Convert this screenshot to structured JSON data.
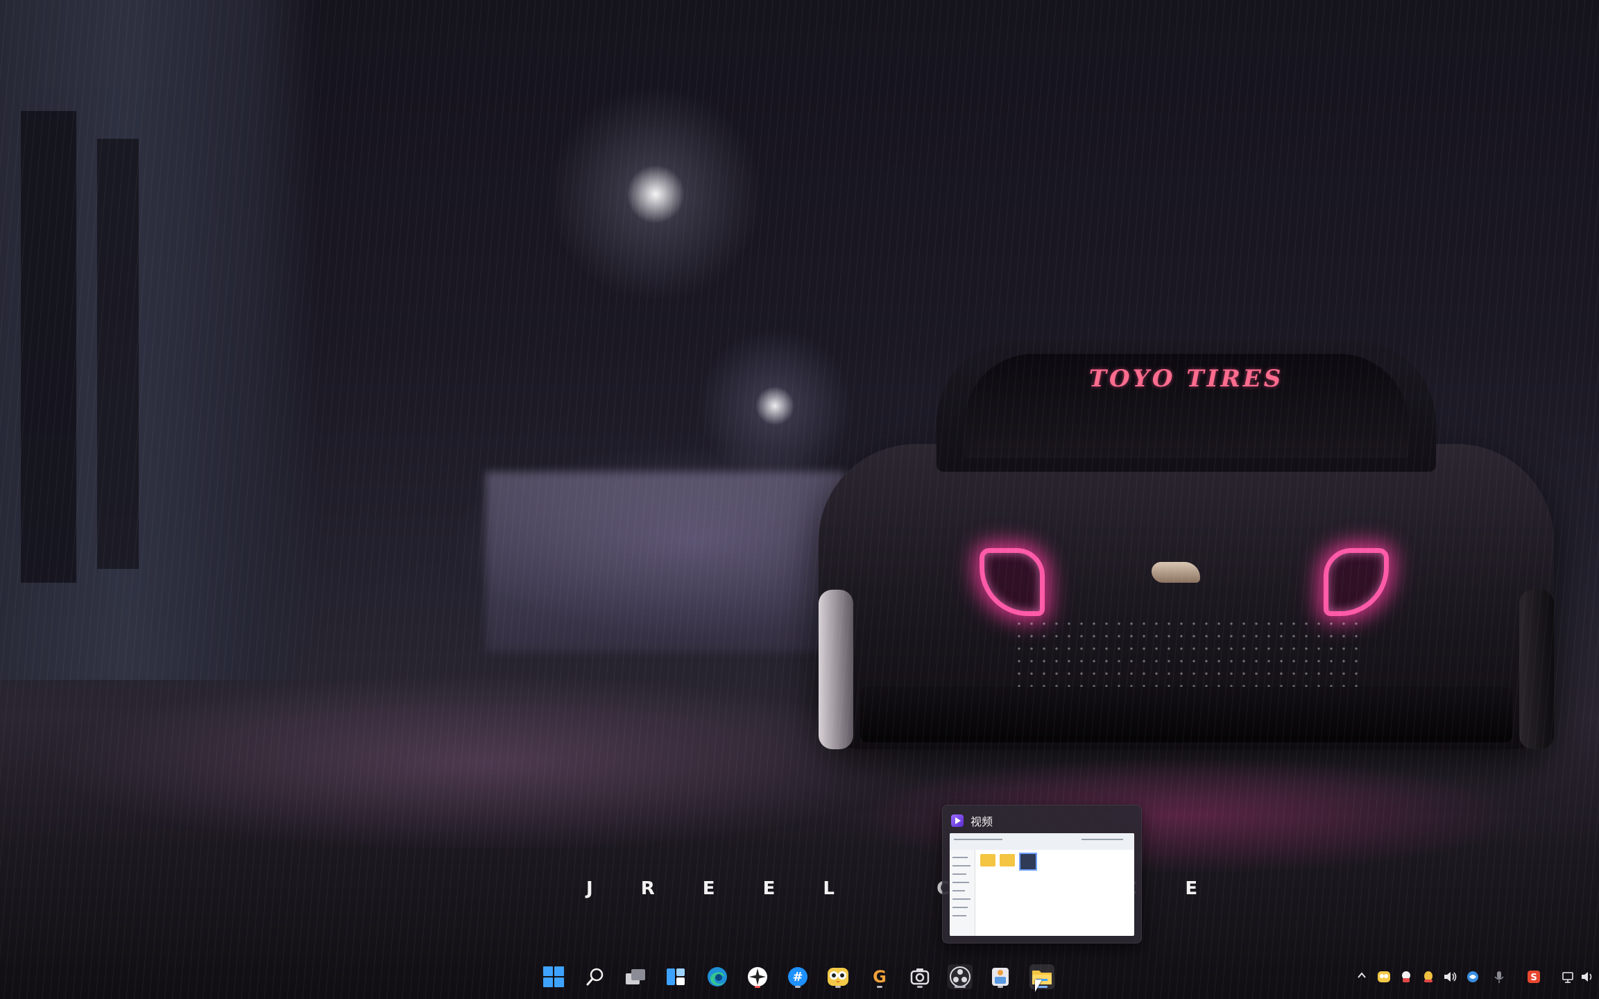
{
  "wallpaper": {
    "windshield_banner": "TOYO TIRES",
    "caption": "J R E E L   C O N C E"
  },
  "thumbnail_popup": {
    "window_title": "视频"
  },
  "taskbar": {
    "pinned": [
      {
        "name": "start-icon"
      },
      {
        "name": "search-icon"
      },
      {
        "name": "task-view-icon"
      },
      {
        "name": "widgets-icon"
      },
      {
        "name": "edge-browser-icon"
      },
      {
        "name": "compass-app-icon"
      },
      {
        "name": "hashtag-app-icon"
      },
      {
        "name": "owl-app-icon"
      },
      {
        "name": "g-app-icon"
      },
      {
        "name": "obs-icon"
      },
      {
        "name": "app-icon"
      },
      {
        "name": "file-explorer-icon"
      }
    ],
    "active_app": "file-explorer-icon"
  },
  "tray": {
    "icons": [
      "chevron-up-icon",
      "owl-tray-icon",
      "app-tray-icon",
      "qq-icon",
      "volume-icon",
      "network-icon",
      "microphone-icon",
      "sogou-ime-icon",
      "display-icon",
      "speaker-icon"
    ]
  },
  "colors": {
    "accent_blue": "#3ea3ff",
    "taillight_pink": "#ff5aa8",
    "banner_pink": "#ff6c8e"
  }
}
